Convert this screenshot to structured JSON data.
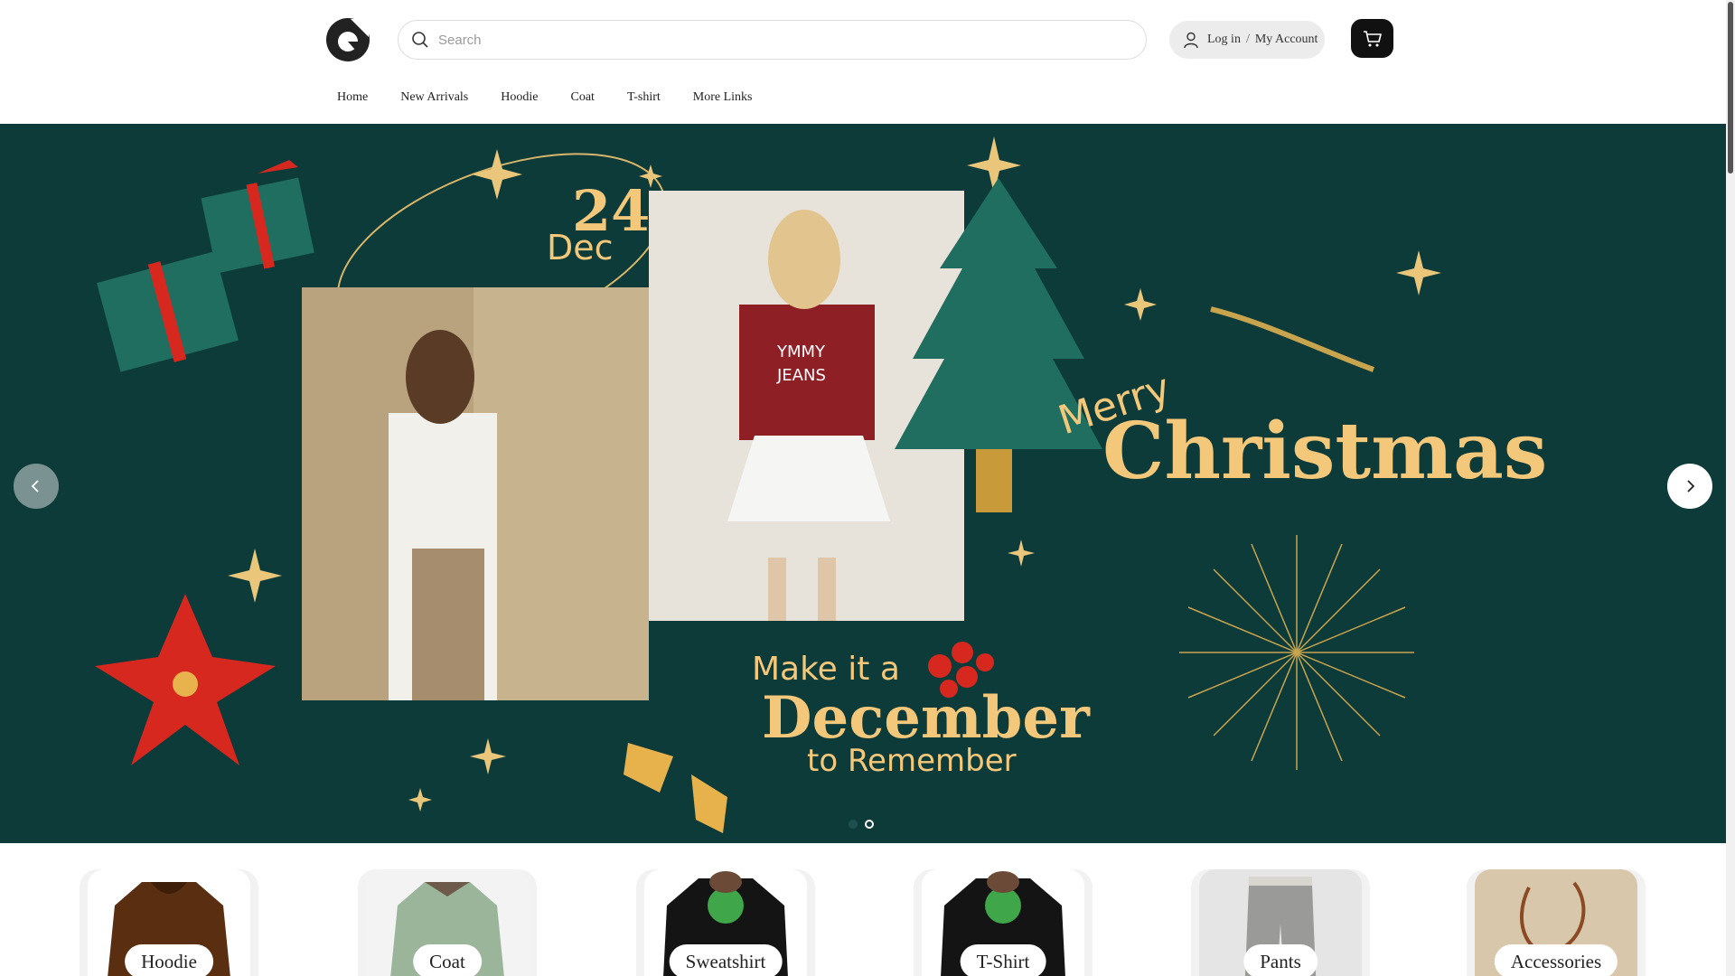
{
  "header": {
    "search": {
      "placeholder": "Search"
    },
    "account": {
      "login_label": "Log in",
      "separator": "/",
      "account_label": "My Account"
    },
    "cart_icon": "cart-icon"
  },
  "nav": {
    "items": [
      {
        "label": "Home"
      },
      {
        "label": "New Arrivals"
      },
      {
        "label": "Hoodie"
      },
      {
        "label": "Coat"
      },
      {
        "label": "T-shirt"
      },
      {
        "label": "More Links"
      }
    ]
  },
  "hero": {
    "background_color": "#0d3b3a",
    "accent_color": "#f4c87a",
    "date_day": "24",
    "date_month": "Dec",
    "headline_small": "Merry",
    "headline_big": "Christmas",
    "tag_line1": "Make it a",
    "tag_line2": "December",
    "tag_line3": "to Remember",
    "photo_text": "YMMY JEANS",
    "slides_total": 2,
    "active_slide": 1
  },
  "categories": [
    {
      "label": "Hoodie"
    },
    {
      "label": "Coat"
    },
    {
      "label": "Sweatshirt"
    },
    {
      "label": "T-Shirt"
    },
    {
      "label": "Pants"
    },
    {
      "label": "Accessories"
    }
  ]
}
